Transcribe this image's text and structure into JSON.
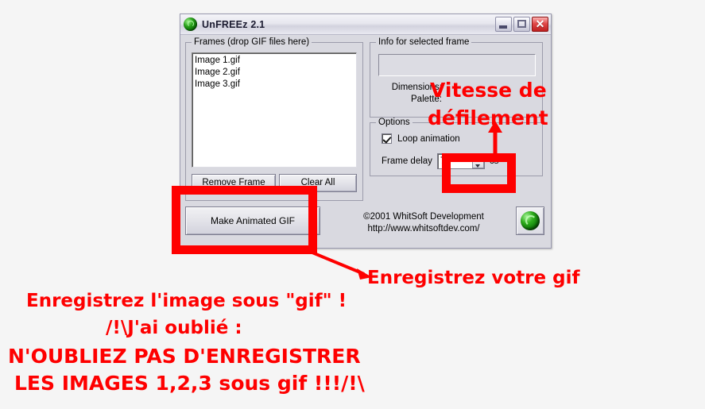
{
  "window": {
    "title": "UnFREEz 2.1",
    "logo_icon": "green-spiral-icon",
    "caption": {
      "minimize": "minimize-icon",
      "maximize": "maximize-icon",
      "close": "✕"
    }
  },
  "frames_group": {
    "legend": "Frames (drop GIF files here)",
    "items": [
      "Image 1.gif",
      "Image 2.gif",
      "Image 3.gif"
    ],
    "remove_button": "Remove Frame",
    "clear_button": "Clear All"
  },
  "info_group": {
    "legend": "Info for selected frame",
    "dimensions_label": "Dimensions:",
    "palette_label": "Palette:",
    "dimensions_value": "",
    "palette_value": ""
  },
  "options_group": {
    "legend": "Options",
    "loop_label": "Loop animation",
    "loop_checked": true,
    "delay_label": "Frame delay",
    "delay_value": "70",
    "delay_unit": "cs"
  },
  "actions": {
    "make_gif": "Make Animated GIF"
  },
  "credits": {
    "line1": "©2001 WhitSoft Development",
    "line2": "http://www.whitsoftdev.com/",
    "logo_icon": "green-spiral-icon"
  },
  "annotations": {
    "vitesse_line1": "Vitesse de",
    "vitesse_line2": "défilement",
    "save_your_gif": "Enregistrez votre gif",
    "note_line1": "Enregistrez l'image sous \"gif\" !",
    "note_line2": "/!\\J'ai oublié :",
    "note_line3": "N'OUBLIEZ PAS D'ENREGISTRER",
    "note_line4": "LES IMAGES 1,2,3 sous gif !!!/!\\",
    "color": "#fe0000"
  }
}
